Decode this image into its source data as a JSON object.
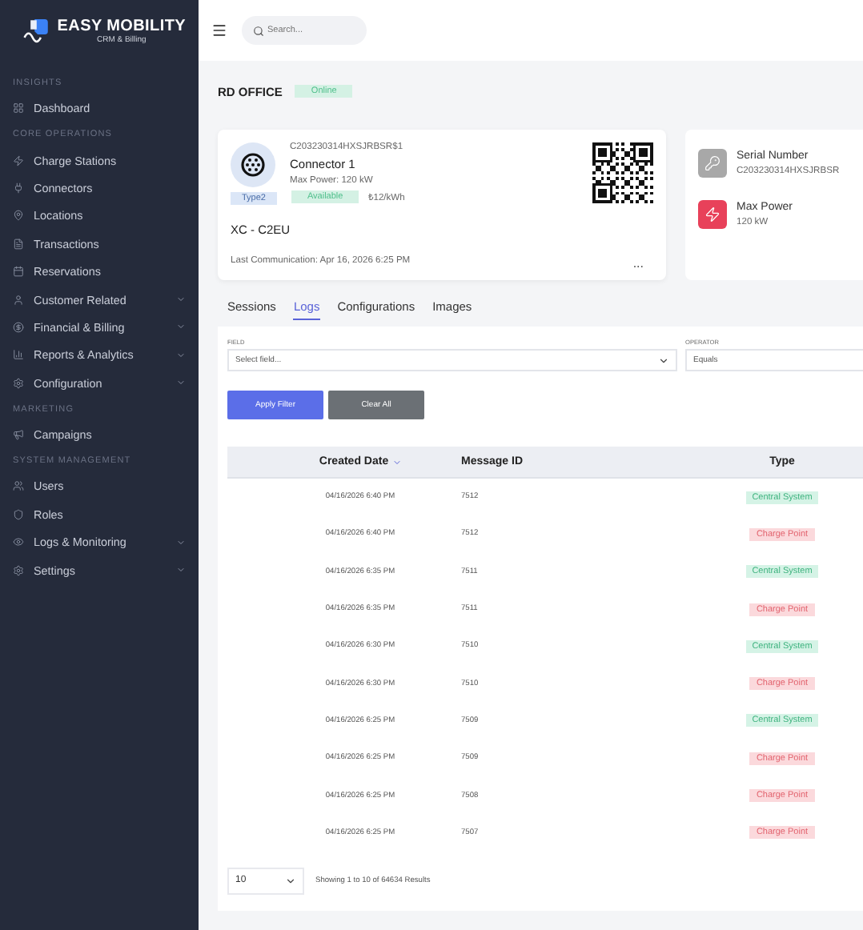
{
  "brand": {
    "name": "EASY MOBILITY",
    "tagline": "CRM & Billing"
  },
  "search": {
    "placeholder": "Search..."
  },
  "sidebar": [
    {
      "heading": "INSIGHTS",
      "items": [
        {
          "label": "Dashboard",
          "kind": "dashboard",
          "has_submenu": false
        }
      ]
    },
    {
      "heading": "CORE OPERATIONS",
      "items": [
        {
          "label": "Charge Stations",
          "kind": "bolt",
          "has_submenu": false
        },
        {
          "label": "Connectors",
          "kind": "plug",
          "has_submenu": false
        },
        {
          "label": "Locations",
          "kind": "pin",
          "has_submenu": false
        },
        {
          "label": "Transactions",
          "kind": "file",
          "has_submenu": false
        },
        {
          "label": "Reservations",
          "kind": "calendar",
          "has_submenu": false
        },
        {
          "label": "Customer Related",
          "kind": "user",
          "has_submenu": true
        },
        {
          "label": "Financial & Billing",
          "kind": "dollar",
          "has_submenu": true
        },
        {
          "label": "Reports & Analytics",
          "kind": "chart",
          "has_submenu": true
        },
        {
          "label": "Configuration",
          "kind": "gear",
          "has_submenu": true
        }
      ]
    },
    {
      "heading": "MARKETING",
      "items": [
        {
          "label": "Campaigns",
          "kind": "megaphone",
          "has_submenu": false
        }
      ]
    },
    {
      "heading": "SYSTEM MANAGEMENT",
      "items": [
        {
          "label": "Users",
          "kind": "users",
          "has_submenu": false
        },
        {
          "label": "Roles",
          "kind": "shield",
          "has_submenu": false
        },
        {
          "label": "Logs & Monitoring",
          "kind": "eye",
          "has_submenu": true
        },
        {
          "label": "Settings",
          "kind": "gear",
          "has_submenu": true
        }
      ]
    }
  ],
  "station": {
    "name": "RD OFFICE",
    "status": "Online"
  },
  "connector": {
    "id": "C203230314HXSJRBSR$1",
    "name": "Connector 1",
    "max_power": "Max Power: 120 kW",
    "type": "Type2",
    "status": "Available",
    "price": "₺12/kWh",
    "model": "XC - C2EU",
    "last_communication": "Last Communication: Apr 16, 2026 6:25 PM",
    "menu": "..."
  },
  "info": [
    {
      "label": "Serial Number",
      "value": "C203230314HXSJRBSR",
      "kind": "key"
    },
    {
      "label": "Max Power",
      "value": "120 kW",
      "kind": "power"
    }
  ],
  "tabs": [
    {
      "label": "Sessions",
      "selected": false
    },
    {
      "label": "Logs",
      "selected": true
    },
    {
      "label": "Configurations",
      "selected": false
    },
    {
      "label": "Images",
      "selected": false
    }
  ],
  "filter": {
    "field_label": "FIELD",
    "field_placeholder": "Select field...",
    "operator_label": "OPERATOR",
    "operator_value": "Equals",
    "apply": "Apply Filter",
    "clear": "Clear All"
  },
  "table": {
    "columns": [
      "Created Date",
      "Message ID",
      "Type"
    ],
    "rows": [
      {
        "date": "04/16/2026 6:40 PM",
        "id": "7512",
        "type": "Central System",
        "kind": "central"
      },
      {
        "date": "04/16/2026 6:40 PM",
        "id": "7512",
        "type": "Charge Point",
        "kind": "charge"
      },
      {
        "date": "04/16/2026 6:35 PM",
        "id": "7511",
        "type": "Central System",
        "kind": "central"
      },
      {
        "date": "04/16/2026 6:35 PM",
        "id": "7511",
        "type": "Charge Point",
        "kind": "charge"
      },
      {
        "date": "04/16/2026 6:30 PM",
        "id": "7510",
        "type": "Central System",
        "kind": "central"
      },
      {
        "date": "04/16/2026 6:30 PM",
        "id": "7510",
        "type": "Charge Point",
        "kind": "charge"
      },
      {
        "date": "04/16/2026 6:25 PM",
        "id": "7509",
        "type": "Central System",
        "kind": "central"
      },
      {
        "date": "04/16/2026 6:25 PM",
        "id": "7509",
        "type": "Charge Point",
        "kind": "charge"
      },
      {
        "date": "04/16/2026 6:25 PM",
        "id": "7508",
        "type": "Charge Point",
        "kind": "charge"
      },
      {
        "date": "04/16/2026 6:25 PM",
        "id": "7507",
        "type": "Charge Point",
        "kind": "charge"
      }
    ]
  },
  "pagination": {
    "page_size": "10",
    "summary": "Showing 1 to 10 of 64634 Results"
  }
}
